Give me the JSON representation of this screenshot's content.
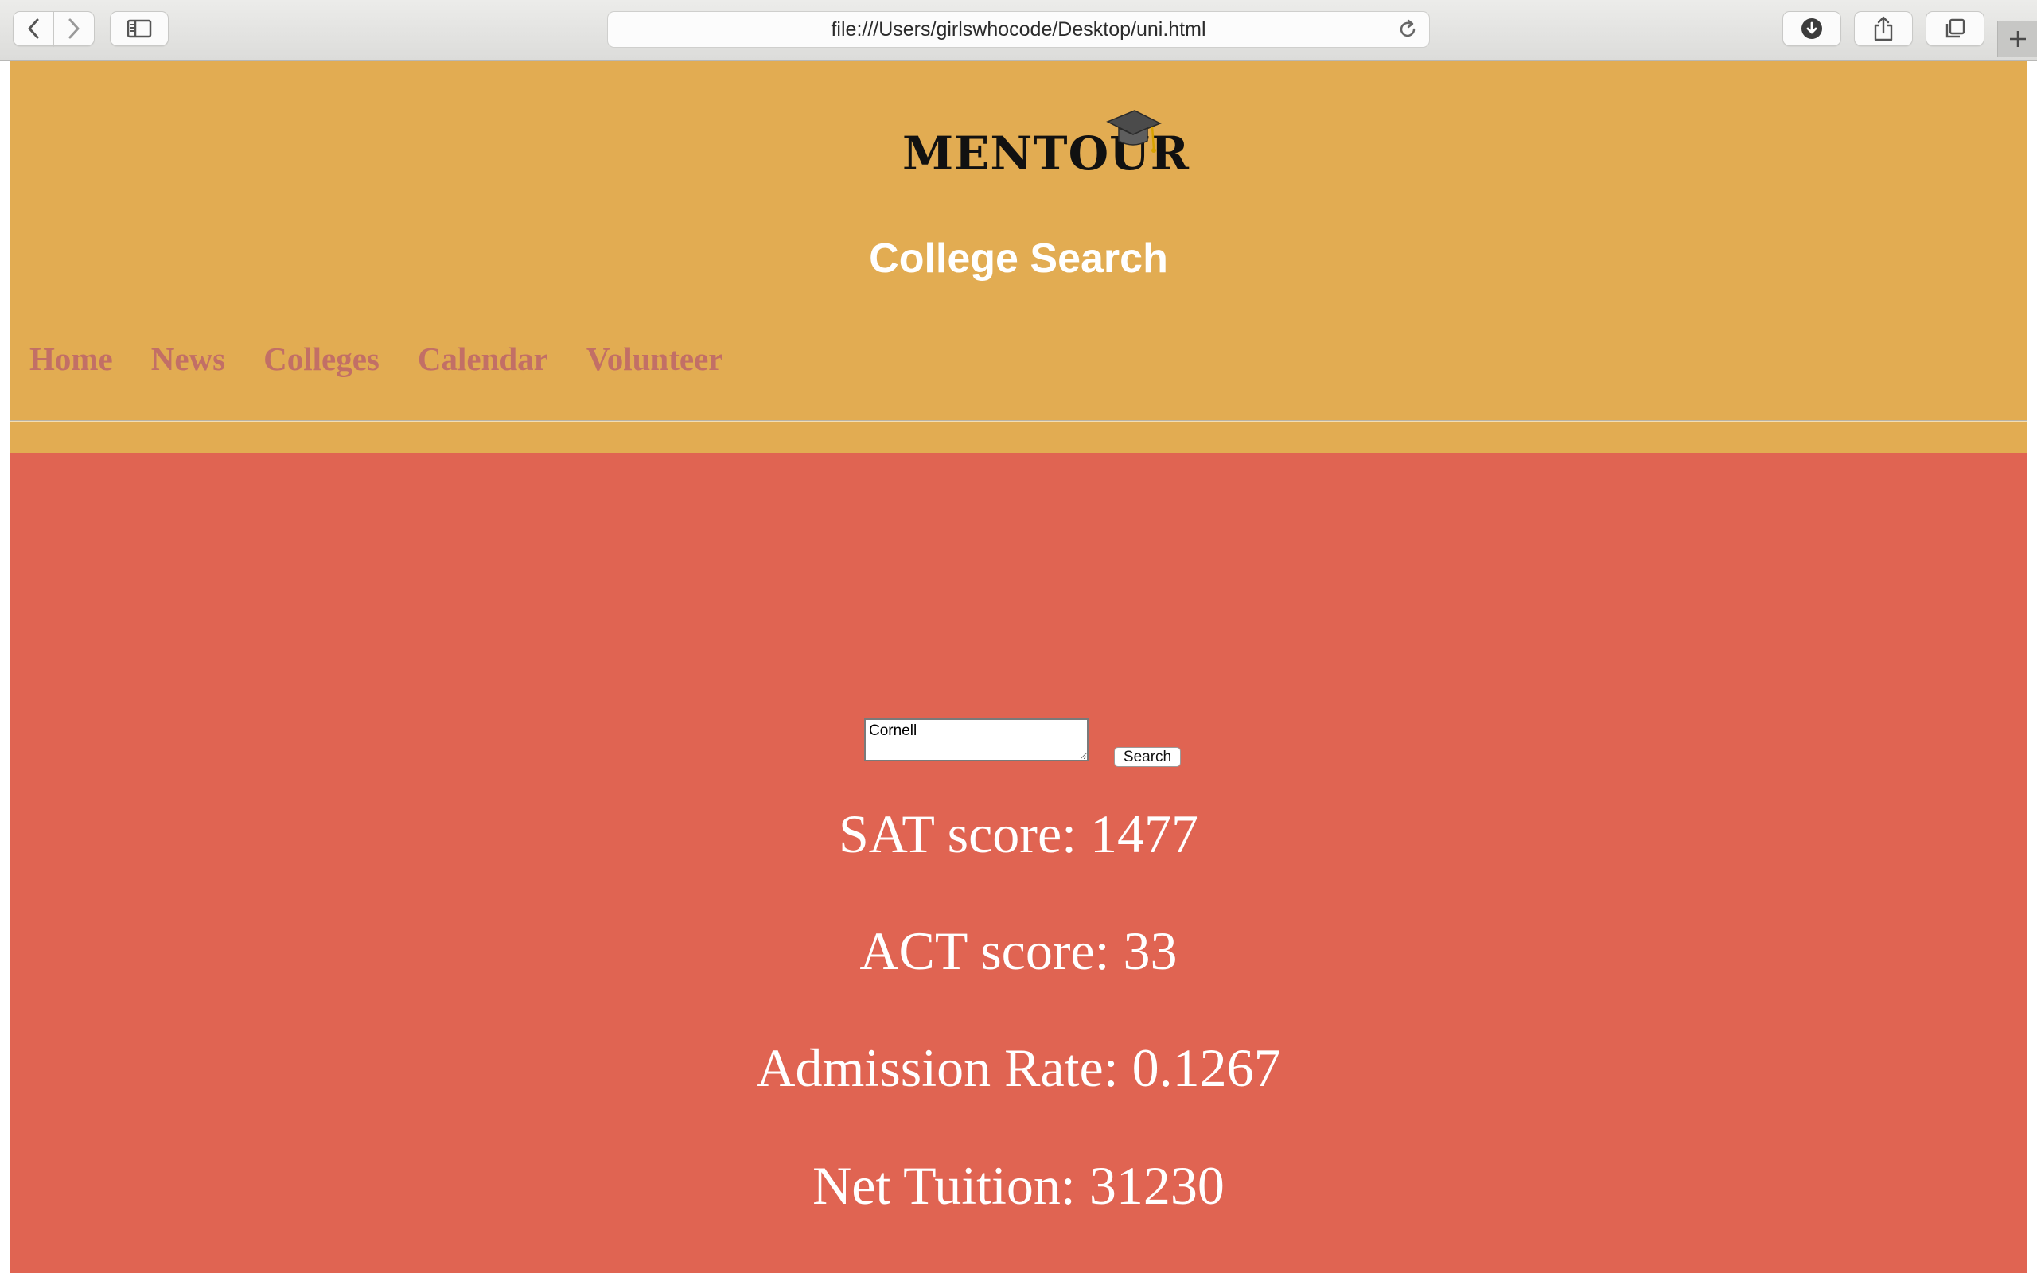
{
  "browser": {
    "url": "file:///Users/girlswhocode/Desktop/uni.html"
  },
  "site": {
    "logo_text": "MENTOUR",
    "title": "College Search",
    "nav": [
      "Home",
      "News",
      "Colleges",
      "Calendar",
      "Volunteer"
    ]
  },
  "search": {
    "value": "Cornell",
    "button_label": "Search"
  },
  "results": {
    "sat": "SAT score: 1477",
    "act": "ACT score: 33",
    "admission": "Admission Rate: 0.1267",
    "tuition": "Net Tuition: 31230"
  },
  "colors": {
    "header_bg": "#e2ac52",
    "main_bg": "#e06452",
    "nav_link": "#c26f66"
  }
}
